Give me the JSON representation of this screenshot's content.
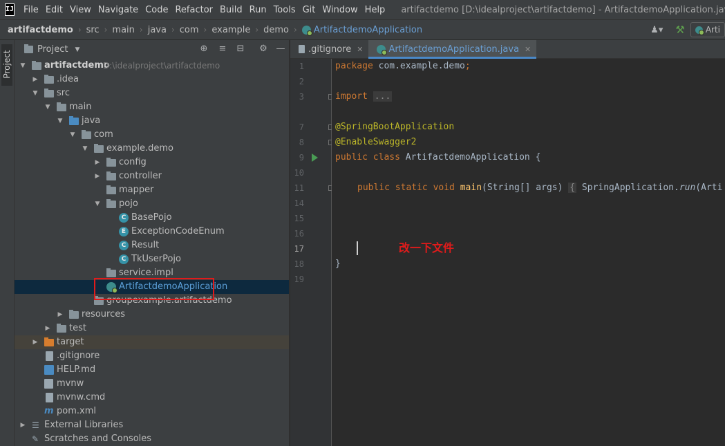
{
  "menubar": {
    "logo": "IJ",
    "items": [
      "File",
      "Edit",
      "View",
      "Navigate",
      "Code",
      "Refactor",
      "Build",
      "Run",
      "Tools",
      "Git",
      "Window",
      "Help"
    ],
    "window_title": "artifactdemo [D:\\idealproject\\artifactdemo] - ArtifactdemoApplication.java - Admin"
  },
  "breadcrumb": [
    "artifactdemo",
    "src",
    "main",
    "java",
    "com",
    "example",
    "demo",
    "ArtifactdemoApplication"
  ],
  "run_config_label": "Arti",
  "toolstrip": {
    "project_label": "Project"
  },
  "project_panel": {
    "title": "Project",
    "tree": [
      {
        "label": "artifactdemo",
        "path": "D:\\idealproject\\artifactdemo"
      },
      {
        "label": ".idea"
      },
      {
        "label": "src"
      },
      {
        "label": "main"
      },
      {
        "label": "java"
      },
      {
        "label": "com"
      },
      {
        "label": "example.demo"
      },
      {
        "label": "config"
      },
      {
        "label": "controller"
      },
      {
        "label": "mapper"
      },
      {
        "label": "pojo"
      },
      {
        "label": "BasePojo"
      },
      {
        "label": "ExceptionCodeEnum"
      },
      {
        "label": "Result"
      },
      {
        "label": "TkUserPojo"
      },
      {
        "label": "service.impl"
      },
      {
        "label": "ArtifactdemoApplication"
      },
      {
        "label": "groupexample.artifactdemo"
      },
      {
        "label": "resources"
      },
      {
        "label": "test"
      },
      {
        "label": "target"
      },
      {
        "label": ".gitignore"
      },
      {
        "label": "HELP.md"
      },
      {
        "label": "mvnw"
      },
      {
        "label": "mvnw.cmd"
      },
      {
        "label": "pom.xml"
      },
      {
        "label": "External Libraries"
      },
      {
        "label": "Scratches and Consoles"
      }
    ]
  },
  "tabs": [
    {
      "label": ".gitignore"
    },
    {
      "label": "ArtifactdemoApplication.java"
    }
  ],
  "editor": {
    "line_numbers": [
      "1",
      "2",
      "3",
      "7",
      "8",
      "9",
      "10",
      "11",
      "14",
      "15",
      "16",
      "17",
      "18",
      "19"
    ],
    "code": {
      "l1_kw": "package",
      "l1_rest": " com.example.demo",
      "l1_semi": ";",
      "l3_kw": "import",
      "l3_fold": "...",
      "l7": "@SpringBootApplication",
      "l8": "@EnableSwagger2",
      "l9_kw": "public class",
      "l9_rest": " ArtifactdemoApplication {",
      "l11_kw": "public static void",
      "l11_fn": "main",
      "l11_args": "(String[] args) ",
      "l11_fold": "{",
      "l11_body1": " SpringApplication.",
      "l11_body2": "run",
      "l11_body3": "(Arti",
      "l18": "}"
    },
    "annotation_text": "改一下文件"
  },
  "colors": {
    "selection": "#0d293e",
    "accent": "#4a88c7",
    "annotation_red": "#e01b1b"
  }
}
